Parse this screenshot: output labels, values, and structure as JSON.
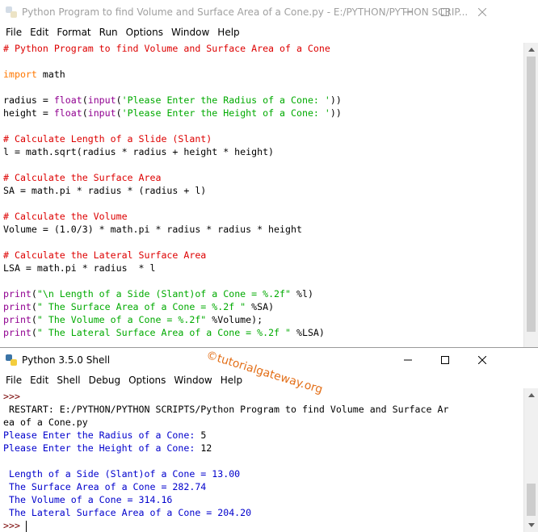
{
  "editor": {
    "title": "Python Program to find Volume and Surface Area of a Cone.py - E:/PYTHON/PYTHON SCRIP...",
    "menu": [
      "File",
      "Edit",
      "Format",
      "Run",
      "Options",
      "Window",
      "Help"
    ],
    "lines": [
      [
        {
          "t": "# Python Program to find Volume and Surface Area of a Cone",
          "c": "comment"
        }
      ],
      [],
      [
        {
          "t": "import",
          "c": "keyword"
        },
        {
          "t": " math"
        }
      ],
      [],
      [
        {
          "t": "radius = "
        },
        {
          "t": "float",
          "c": "builtin"
        },
        {
          "t": "("
        },
        {
          "t": "input",
          "c": "builtin"
        },
        {
          "t": "("
        },
        {
          "t": "'Please Enter the Radius of a Cone: '",
          "c": "string"
        },
        {
          "t": "))"
        }
      ],
      [
        {
          "t": "height = "
        },
        {
          "t": "float",
          "c": "builtin"
        },
        {
          "t": "("
        },
        {
          "t": "input",
          "c": "builtin"
        },
        {
          "t": "("
        },
        {
          "t": "'Please Enter the Height of a Cone: '",
          "c": "string"
        },
        {
          "t": "))"
        }
      ],
      [],
      [
        {
          "t": "# Calculate Length of a Slide (Slant)",
          "c": "comment"
        }
      ],
      [
        {
          "t": "l = math.sqrt(radius * radius + height * height)"
        }
      ],
      [],
      [
        {
          "t": "# Calculate the Surface Area",
          "c": "comment"
        }
      ],
      [
        {
          "t": "SA = math.pi * radius * (radius + l)"
        }
      ],
      [],
      [
        {
          "t": "# Calculate the Volume",
          "c": "comment"
        }
      ],
      [
        {
          "t": "Volume = (1.0/3) * math.pi * radius * radius * height"
        }
      ],
      [],
      [
        {
          "t": "# Calculate the Lateral Surface Area",
          "c": "comment"
        }
      ],
      [
        {
          "t": "LSA = math.pi * radius  * l"
        }
      ],
      [],
      [
        {
          "t": "print",
          "c": "builtin"
        },
        {
          "t": "("
        },
        {
          "t": "\"\\n Length of a Side (Slant)of a Cone = %.2f\"",
          "c": "string"
        },
        {
          "t": " %l)"
        }
      ],
      [
        {
          "t": "print",
          "c": "builtin"
        },
        {
          "t": "("
        },
        {
          "t": "\" The Surface Area of a Cone = %.2f \"",
          "c": "string"
        },
        {
          "t": " %SA)"
        }
      ],
      [
        {
          "t": "print",
          "c": "builtin"
        },
        {
          "t": "("
        },
        {
          "t": "\" The Volume of a Cone = %.2f\"",
          "c": "string"
        },
        {
          "t": " %Volume);"
        }
      ],
      [
        {
          "t": "print",
          "c": "builtin"
        },
        {
          "t": "("
        },
        {
          "t": "\" The Lateral Surface Area of a Cone = %.2f \"",
          "c": "string"
        },
        {
          "t": " %LSA)"
        }
      ]
    ]
  },
  "shell": {
    "title": "Python 3.5.0 Shell",
    "menu": [
      "File",
      "Edit",
      "Shell",
      "Debug",
      "Options",
      "Window",
      "Help"
    ],
    "lines": [
      [
        {
          "t": ">>>",
          "c": "prompt"
        }
      ],
      [
        {
          "t": " RESTART: E:/PYTHON/PYTHON SCRIPTS/Python Program to find Volume and Surface Ar"
        }
      ],
      [
        {
          "t": "ea of a Cone.py"
        }
      ],
      [
        {
          "t": "Please Enter the Radius of a Cone: ",
          "c": "out"
        },
        {
          "t": "5"
        }
      ],
      [
        {
          "t": "Please Enter the Height of a Cone: ",
          "c": "out"
        },
        {
          "t": "12"
        }
      ],
      [],
      [
        {
          "t": " Length of a Side (Slant)of a Cone = 13.00",
          "c": "out"
        }
      ],
      [
        {
          "t": " The Surface Area of a Cone = 282.74",
          "c": "out"
        }
      ],
      [
        {
          "t": " The Volume of a Cone = 314.16",
          "c": "out"
        }
      ],
      [
        {
          "t": " The Lateral Surface Area of a Cone = 204.20",
          "c": "out"
        }
      ],
      [
        {
          "t": ">>> ",
          "c": "prompt"
        }
      ]
    ]
  },
  "watermark": "©tutorialgateway.org",
  "colors": {
    "comment": "#dd0000",
    "keyword": "#ff7700",
    "builtin": "#900090",
    "string": "#00aa00",
    "output": "#0000cc",
    "prompt": "#770000"
  }
}
